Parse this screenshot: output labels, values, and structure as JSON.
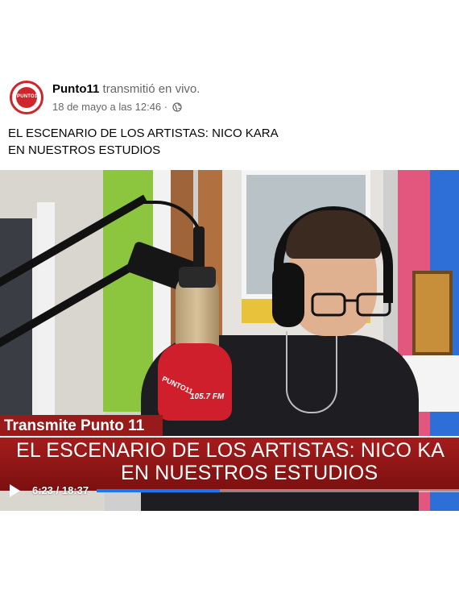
{
  "post": {
    "author": "Punto11",
    "action": " transmitió en vivo.",
    "date": "18 de mayo a las 12:46",
    "separator": "·",
    "privacy_icon": "globe-icon",
    "text_line1": "EL ESCENARIO DE LOS ARTISTAS: NICO KARA",
    "text_line2": "EN NUESTROS ESTUDIOS"
  },
  "avatar": {
    "logo_text": "PUNTO11",
    "color": "#d0262b"
  },
  "video": {
    "mic_flag_logo": "PUNTO11",
    "mic_flag_freq": "105.7 FM",
    "lower_third_tab": "Transmite Punto 11",
    "banner_line1": "EL ESCENARIO DE LOS ARTISTAS: NICO KA",
    "banner_line2": "EN NUESTROS ESTUDIOS",
    "time_display": "6:23 / 18:37",
    "progress": 0.34,
    "play_icon": "play-icon",
    "progress_color": "#1877f2",
    "banner_color": "#991a1a"
  }
}
